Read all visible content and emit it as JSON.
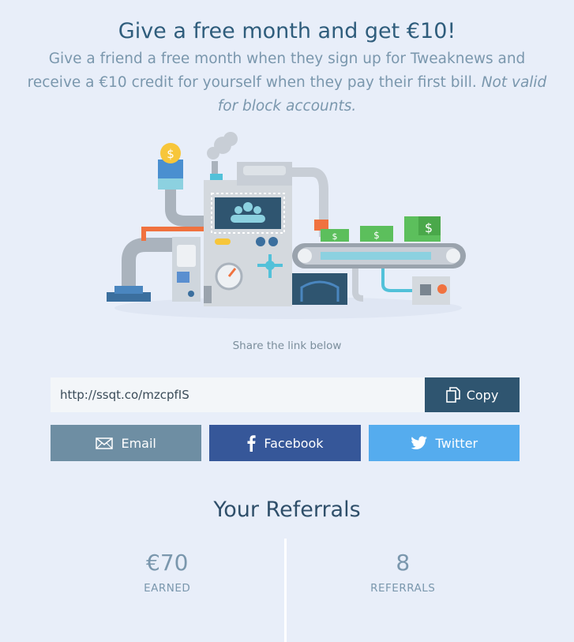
{
  "header": {
    "title": "Give a free month and get €10!",
    "description": "Give a friend a free month when they sign up for Tweaknews and receive a €10 credit for yourself when they pay their first bill.",
    "note": "Not valid for block accounts."
  },
  "illustration": {
    "icon": "money-machine-illustration",
    "money_symbol": "$"
  },
  "share": {
    "label": "Share the link below",
    "link": "http://ssqt.co/mzcpfIS",
    "copy_label": "Copy",
    "email_label": "Email",
    "facebook_label": "Facebook",
    "twitter_label": "Twitter"
  },
  "referrals": {
    "title": "Your Referrals",
    "earned_value": "€70",
    "earned_label": "EARNED",
    "count_value": "8",
    "count_label": "REFERRALS"
  },
  "colors": {
    "background": "#e8eef9",
    "copy_button": "#2f5570",
    "email_button": "#6e8ea3",
    "facebook_button": "#365799",
    "twitter_button": "#55acee"
  }
}
